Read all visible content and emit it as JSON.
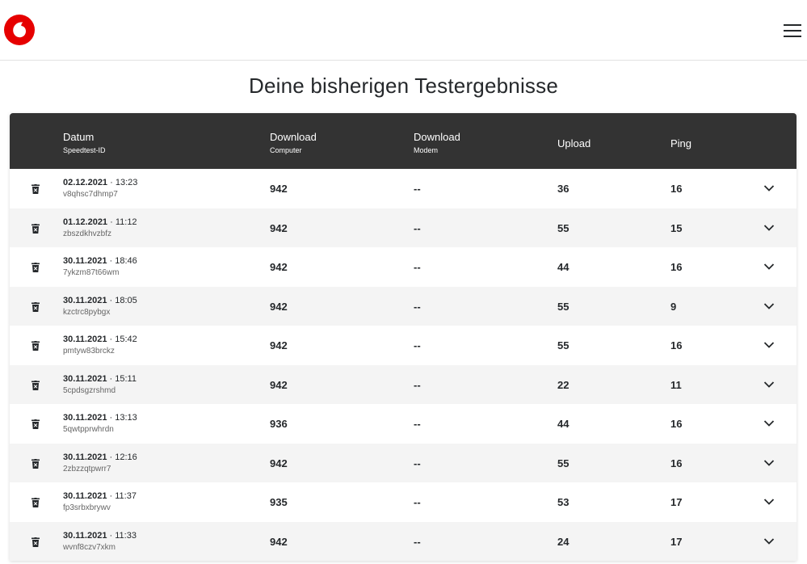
{
  "header": {
    "logo_icon": "vodafone-logo-icon",
    "menu_icon": "hamburger-menu-icon",
    "brand_color": "#e60000"
  },
  "page_title": "Deine bisherigen Testergebnisse",
  "table": {
    "columns": {
      "datum": "Datum",
      "datum_sub": "Speedtest-ID",
      "download_computer": "Download",
      "download_computer_sub": "Computer",
      "download_modem": "Download",
      "download_modem_sub": "Modem",
      "upload": "Upload",
      "ping": "Ping"
    },
    "rows": [
      {
        "date": "02.12.2021",
        "time": "· 13:23",
        "id": "v8qhsc7dhmp7",
        "download_computer": "942",
        "download_modem": "--",
        "upload": "36",
        "ping": "16"
      },
      {
        "date": "01.12.2021",
        "time": "· 11:12",
        "id": "zbszdkhvzbfz",
        "download_computer": "942",
        "download_modem": "--",
        "upload": "55",
        "ping": "15"
      },
      {
        "date": "30.11.2021",
        "time": "· 18:46",
        "id": "7ykzm87t66wm",
        "download_computer": "942",
        "download_modem": "--",
        "upload": "44",
        "ping": "16"
      },
      {
        "date": "30.11.2021",
        "time": "· 18:05",
        "id": "kzctrc8pybgx",
        "download_computer": "942",
        "download_modem": "--",
        "upload": "55",
        "ping": "9"
      },
      {
        "date": "30.11.2021",
        "time": "· 15:42",
        "id": "pmtyw83brckz",
        "download_computer": "942",
        "download_modem": "--",
        "upload": "55",
        "ping": "16"
      },
      {
        "date": "30.11.2021",
        "time": "· 15:11",
        "id": "5cpdsgzrshmd",
        "download_computer": "942",
        "download_modem": "--",
        "upload": "22",
        "ping": "11"
      },
      {
        "date": "30.11.2021",
        "time": "· 13:13",
        "id": "5qwtpprwhrdn",
        "download_computer": "936",
        "download_modem": "--",
        "upload": "44",
        "ping": "16"
      },
      {
        "date": "30.11.2021",
        "time": "· 12:16",
        "id": "2zbzzqtpwrr7",
        "download_computer": "942",
        "download_modem": "--",
        "upload": "55",
        "ping": "16"
      },
      {
        "date": "30.11.2021",
        "time": "· 11:37",
        "id": "fp3srbxbrywv",
        "download_computer": "935",
        "download_modem": "--",
        "upload": "53",
        "ping": "17"
      },
      {
        "date": "30.11.2021",
        "time": "· 11:33",
        "id": "wvnf8czv7xkm",
        "download_computer": "942",
        "download_modem": "--",
        "upload": "24",
        "ping": "17"
      }
    ],
    "row_icons": {
      "delete": "trash-icon",
      "expand": "chevron-down-icon"
    }
  }
}
